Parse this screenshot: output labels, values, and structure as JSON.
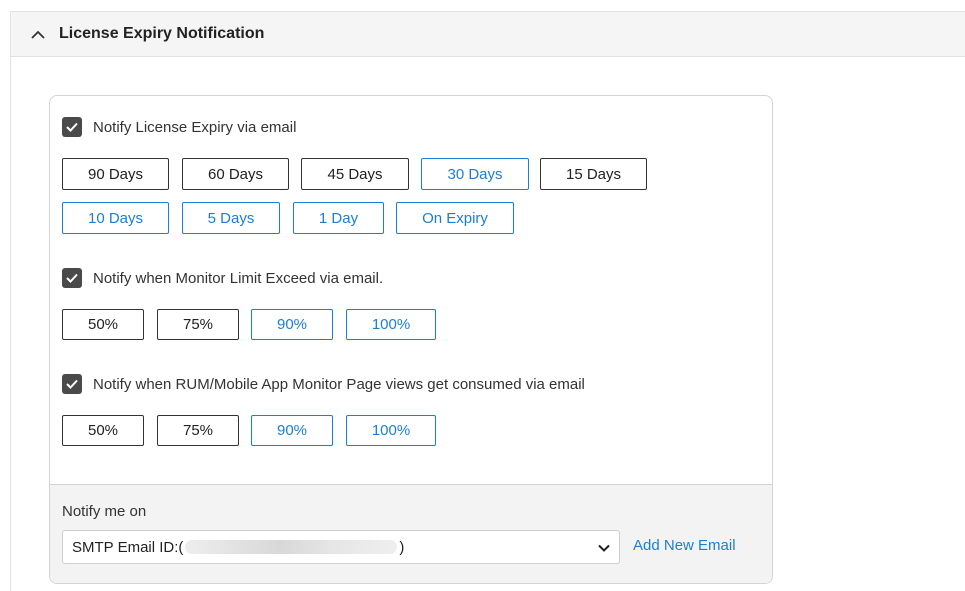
{
  "header": {
    "title": "License Expiry Notification"
  },
  "expiry": {
    "label": "Notify License Expiry via email",
    "checked": true,
    "options": [
      {
        "label": "90 Days",
        "selected": false
      },
      {
        "label": "60 Days",
        "selected": false
      },
      {
        "label": "45 Days",
        "selected": false
      },
      {
        "label": "30 Days",
        "selected": true
      },
      {
        "label": "15 Days",
        "selected": false
      },
      {
        "label": "10 Days",
        "selected": true
      },
      {
        "label": "5 Days",
        "selected": true
      },
      {
        "label": "1 Day",
        "selected": true
      },
      {
        "label": "On Expiry",
        "selected": true
      }
    ]
  },
  "monitor_limit": {
    "label": "Notify when Monitor Limit Exceed via email.",
    "checked": true,
    "options": [
      {
        "label": "50%",
        "selected": false
      },
      {
        "label": "75%",
        "selected": false
      },
      {
        "label": "90%",
        "selected": true
      },
      {
        "label": "100%",
        "selected": true
      }
    ]
  },
  "page_views": {
    "label": "Notify when RUM/Mobile App Monitor Page views get consumed via email",
    "checked": true,
    "options": [
      {
        "label": "50%",
        "selected": false
      },
      {
        "label": "75%",
        "selected": false
      },
      {
        "label": "90%",
        "selected": true
      },
      {
        "label": "100%",
        "selected": true
      }
    ]
  },
  "footer": {
    "notify_label": "Notify me on",
    "select_prefix": "SMTP Email ID:(",
    "select_suffix": ")",
    "add_email": "Add New Email"
  },
  "colors": {
    "accent": "#1a7fd4",
    "checkbox": "#4a4a4a",
    "header_bg": "#f5f5f5"
  },
  "icons": {
    "collapse": "chevron-up-icon",
    "checkbox": "check-icon",
    "dropdown": "chevron-down-icon"
  }
}
